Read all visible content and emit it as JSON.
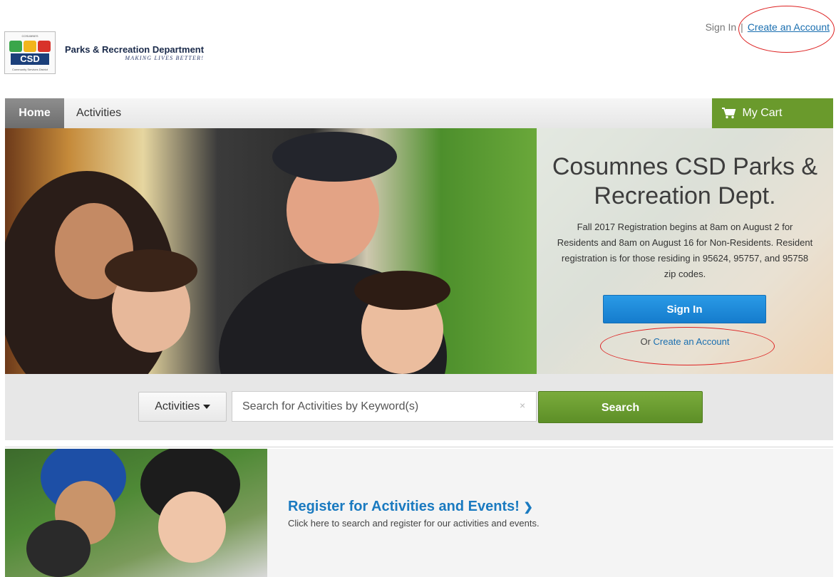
{
  "header": {
    "sign_in": "Sign In",
    "separator": "|",
    "create_account": "Create an Account",
    "logo_title": "Parks & Recreation Department",
    "logo_tagline": "MAKING LIVES BETTER!",
    "logo_badge_text": "CSD",
    "logo_badge_top": "COSUMNES",
    "logo_badge_bottom": "Community Services District"
  },
  "nav": {
    "home": "Home",
    "activities": "Activities",
    "cart": "My Cart"
  },
  "hero": {
    "title": "Cosumnes CSD Parks & Recreation Dept.",
    "description": "Fall 2017 Registration begins at 8am on August 2 for Residents and 8am on August 16 for Non-Residents. Resident registration is for those residing in 95624, 95757, and 95758 zip codes.",
    "sign_in_button": "Sign In",
    "or_text": "Or",
    "create_account_link": "Create an Account"
  },
  "search": {
    "category": "Activities",
    "placeholder": "Search for Activities by Keyword(s)",
    "clear": "×",
    "button": "Search"
  },
  "promo": {
    "title": "Register for Activities and Events!",
    "chevron": "❯",
    "description": "Click here to search and register for our activities and events."
  },
  "colors": {
    "accent_green": "#6a9a2c",
    "link_blue": "#1a6fb0",
    "signin_blue": "#1f8bd9",
    "annotation_red": "#dd2222"
  }
}
